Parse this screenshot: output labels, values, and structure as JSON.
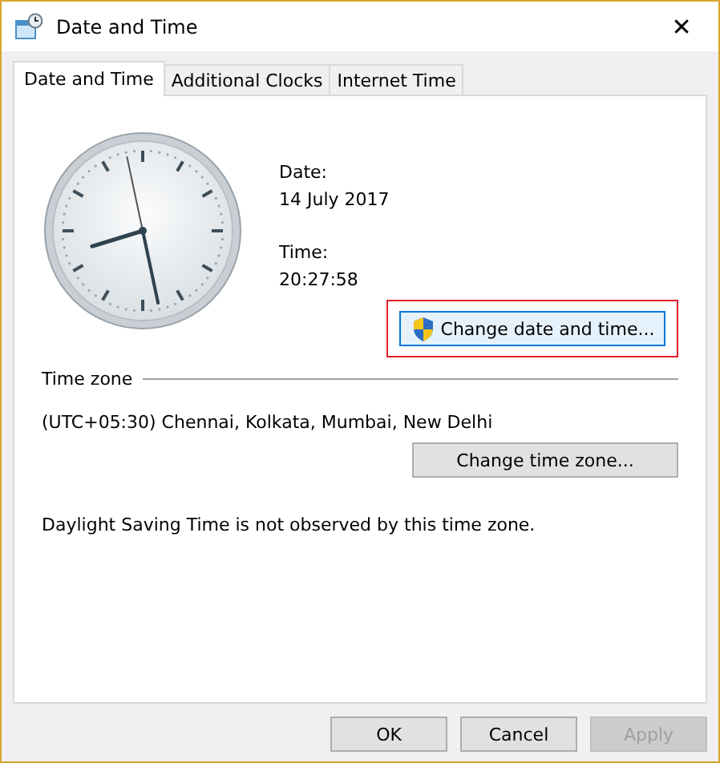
{
  "window": {
    "title": "Date and Time",
    "close": "✕"
  },
  "tabs": [
    {
      "label": "Date and Time",
      "selected": true
    },
    {
      "label": "Additional Clocks",
      "selected": false
    },
    {
      "label": "Internet Time",
      "selected": false
    }
  ],
  "date": {
    "label": "Date:",
    "value": "14 July 2017"
  },
  "time": {
    "label": "Time:",
    "value": "20:27:58"
  },
  "change_button": {
    "label": "Change date and time...",
    "highlighted": true
  },
  "time_zone": {
    "heading": "Time zone",
    "value": "(UTC+05:30) Chennai, Kolkata, Mumbai, New Delhi",
    "button": "Change time zone...",
    "note": "Daylight Saving Time is not observed by this time zone."
  },
  "buttons": [
    {
      "label": "OK",
      "disabled": false
    },
    {
      "label": "Cancel",
      "disabled": false
    },
    {
      "label": "Apply",
      "disabled": true
    }
  ]
}
